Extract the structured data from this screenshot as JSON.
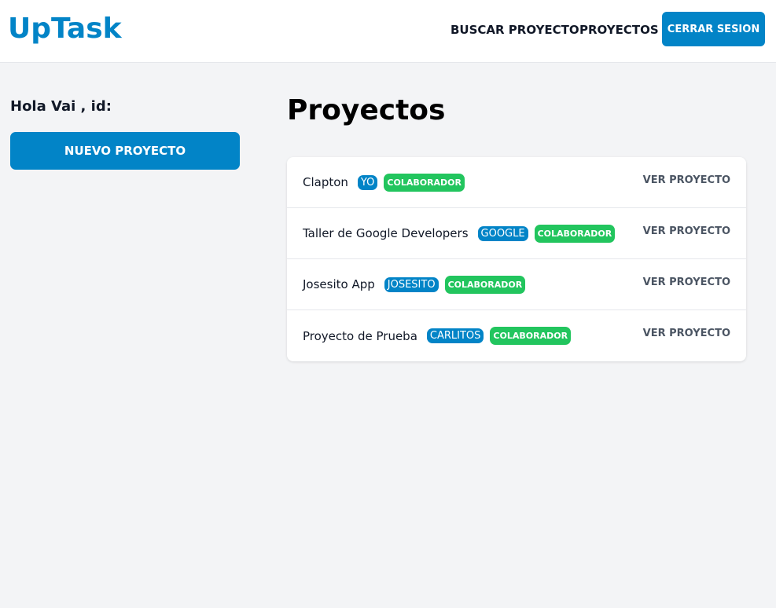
{
  "header": {
    "logo": "UpTask",
    "nav_search": "BUSCAR PROYECTO",
    "nav_projects": "PROYECTOS",
    "logout": "CERRAR SESION"
  },
  "sidebar": {
    "greeting": "Hola Vai , id:",
    "new_project": "NUEVO PROYECTO"
  },
  "main": {
    "title": "Proyectos",
    "projects": [
      {
        "name": "Clapton",
        "owner": "YO",
        "role": "COLABORADOR",
        "action": "VER PROYECTO"
      },
      {
        "name": "Taller de Google Developers",
        "owner": "GOOGLE",
        "role": "COLABORADOR",
        "action": "VER PROYECTO"
      },
      {
        "name": "Josesito App",
        "owner": "JOSESITO",
        "role": "COLABORADOR",
        "action": "VER PROYECTO"
      },
      {
        "name": "Proyecto de Prueba",
        "owner": "CARLITOS",
        "role": "COLABORADOR",
        "action": "VER PROYECTO"
      }
    ]
  },
  "colors": {
    "brand": "#0284c7",
    "collaborator": "#22c55e",
    "background": "#f3f4f6"
  }
}
